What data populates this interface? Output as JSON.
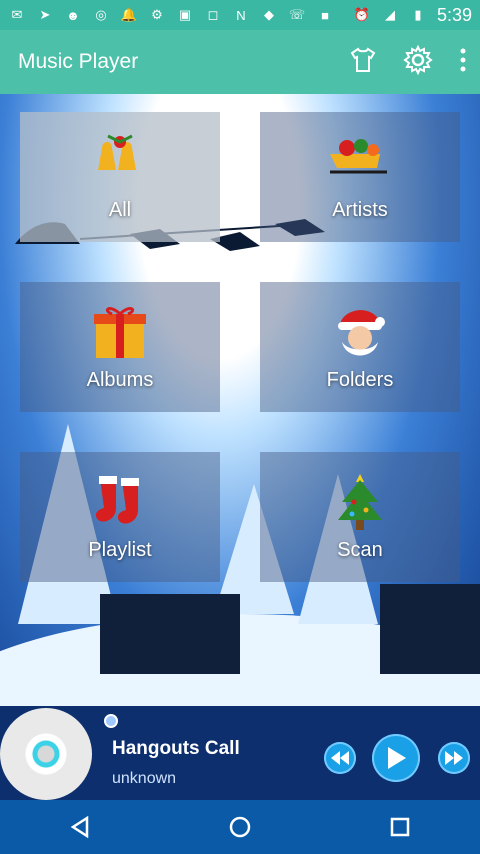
{
  "status_bar": {
    "time": "5:39"
  },
  "app_bar": {
    "title": "Music Player"
  },
  "tiles": [
    {
      "label": "All"
    },
    {
      "label": "Artists"
    },
    {
      "label": "Albums"
    },
    {
      "label": "Folders"
    },
    {
      "label": "Playlist"
    },
    {
      "label": "Scan"
    }
  ],
  "now_playing": {
    "title": "Hangouts Call",
    "artist": "unknown"
  },
  "colors": {
    "accent": "#4cc0a8",
    "status": "#3bb8a3",
    "nav": "#0b5aa7"
  },
  "icons": [
    "tshirt-icon",
    "gear-icon",
    "more-vert-icon",
    "cd-icon",
    "rewind-icon",
    "play-icon",
    "fast-forward-icon",
    "back-icon",
    "home-icon",
    "recents-icon"
  ]
}
